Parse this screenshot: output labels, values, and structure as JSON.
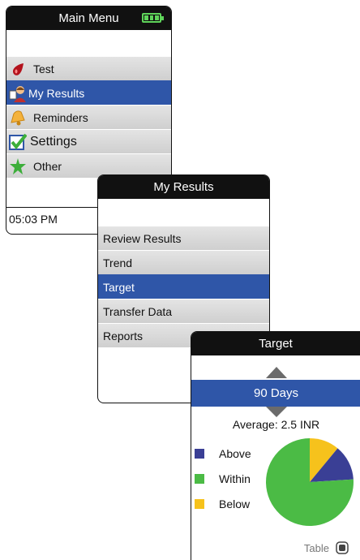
{
  "main_menu": {
    "title": "Main Menu",
    "items": [
      {
        "label": "Test",
        "icon": "blood-drop-icon"
      },
      {
        "label": "My Results",
        "icon": "person-icon"
      },
      {
        "label": "Reminders",
        "icon": "bell-icon"
      },
      {
        "label": "Settings",
        "icon": "checkbox-icon"
      },
      {
        "label": "Other",
        "icon": "star-icon"
      }
    ],
    "selected": "My Results",
    "time": "05:03 PM"
  },
  "my_results": {
    "title": "My Results",
    "items": [
      "Review Results",
      "Trend",
      "Target",
      "Transfer Data",
      "Reports"
    ],
    "selected": "Target"
  },
  "target": {
    "title": "Target",
    "period": "90 Days",
    "average": "Average: 2.5 INR",
    "table_label": "Table",
    "legend": [
      {
        "label": "Above",
        "color": "#3a3f95"
      },
      {
        "label": "Within",
        "color": "#4bbb45"
      },
      {
        "label": "Below",
        "color": "#f6c21c"
      }
    ]
  },
  "chart_data": {
    "type": "pie",
    "labels": [
      "Above",
      "Within",
      "Below"
    ],
    "values": [
      13,
      76,
      11
    ],
    "colors": [
      "#3a3f95",
      "#4bbb45",
      "#f6c21c"
    ]
  }
}
